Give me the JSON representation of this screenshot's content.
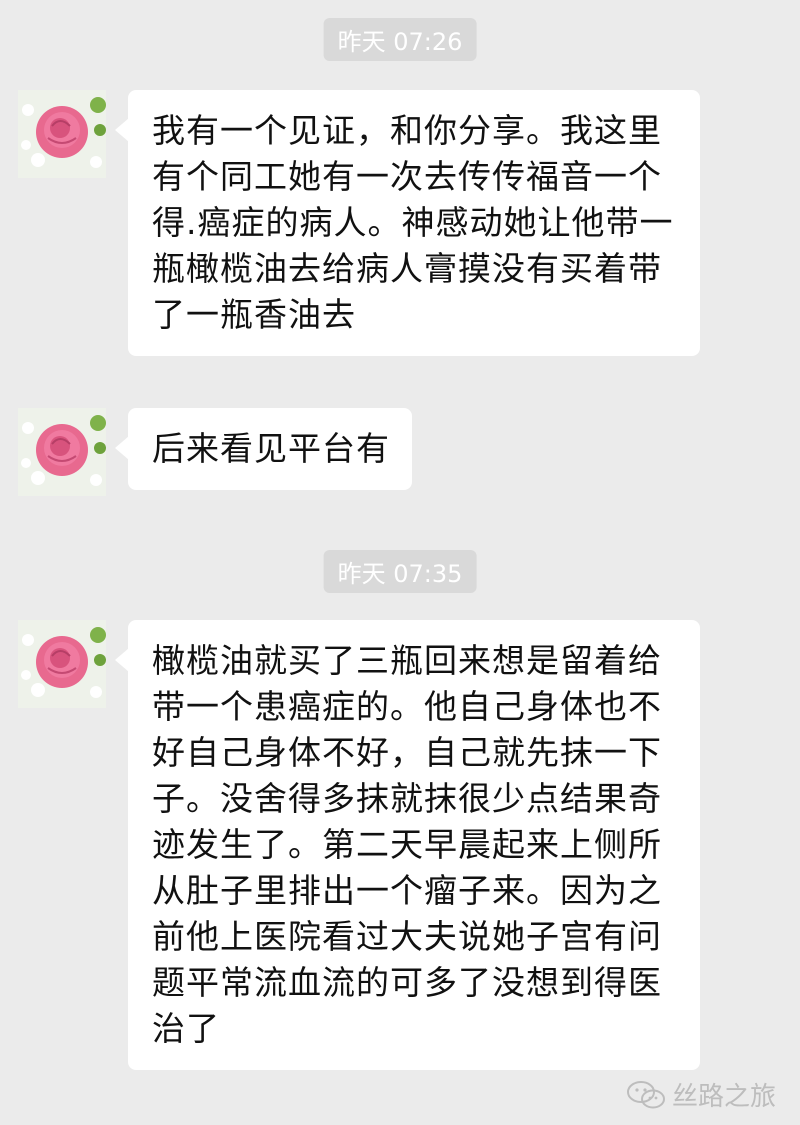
{
  "chat": {
    "timestamps": [
      "昨天 07:26",
      "昨天 07:35"
    ],
    "messages": [
      {
        "text": "我有一个见证，和你分享。我这里有个同工她有一次去传传福音一个得.癌症的病人。神感动她让他带一瓶橄榄油去给病人膏摸没有买着带了一瓶香油去"
      },
      {
        "text": "后来看见平台有"
      },
      {
        "text": "橄榄油就买了三瓶回来想是留着给带一个患癌症的。他自己身体也不好自己身体不好，自己就先抹一下子。没舍得多抹就抹很少点结果奇迹发生了。第二天早晨起来上侧所从肚子里排出一个瘤子来。因为之前他上医院看过大夫说她子宫有问题平常流血流的可多了没想到得医治了"
      }
    ]
  },
  "watermark": {
    "text": "丝路之旅",
    "icon": "wechat-icon"
  },
  "colors": {
    "background": "#ebebeb",
    "bubble": "#ffffff",
    "timestamp_bg": "#d9d9d9"
  }
}
